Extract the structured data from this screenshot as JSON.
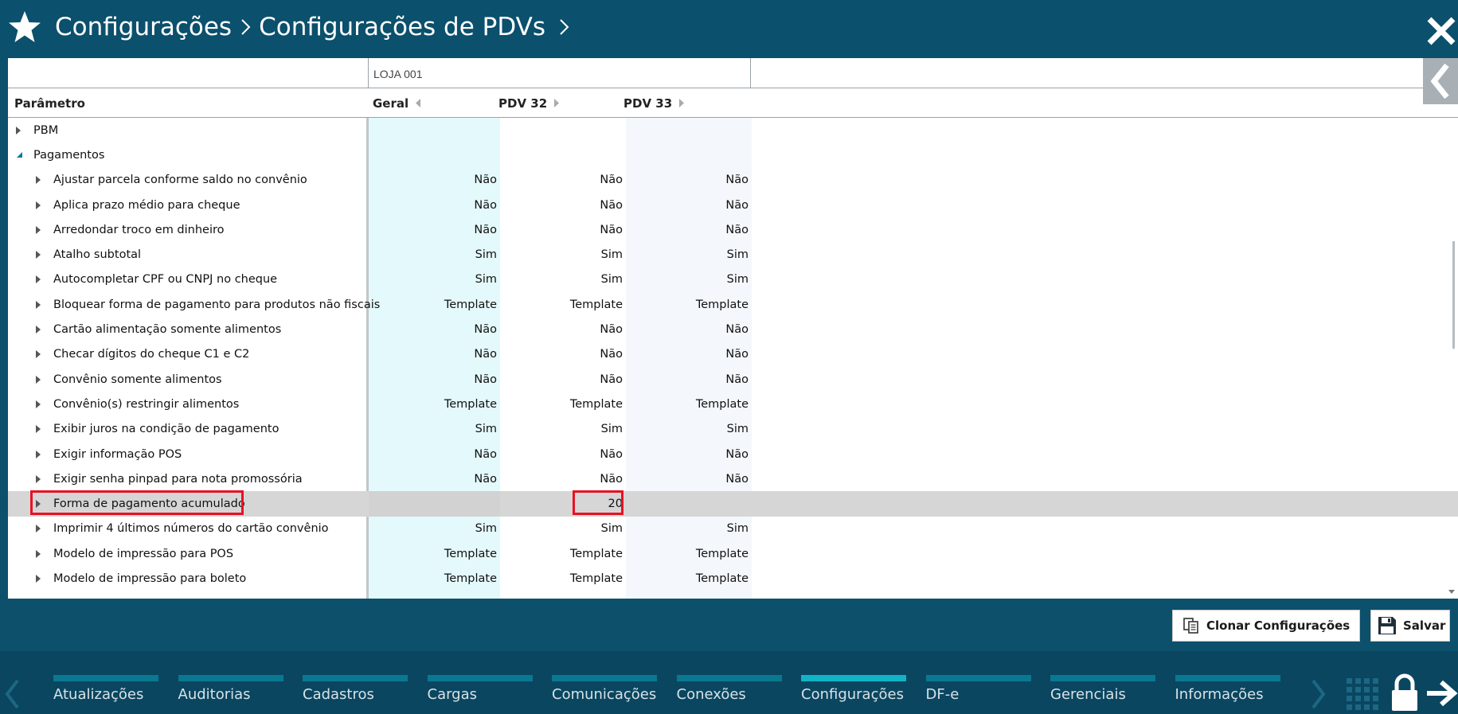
{
  "header": {
    "breadcrumbs": [
      "Configurações",
      "Configurações de PDVs"
    ]
  },
  "table": {
    "group_label": "LOJA 001",
    "columns": {
      "param": "Parâmetro",
      "geral": "Geral",
      "pdv32": "PDV 32",
      "pdv33": "PDV 33"
    },
    "rows": [
      {
        "label": "PBM",
        "level": 0,
        "expanded": false,
        "geral": "",
        "pdv32": "",
        "pdv33": ""
      },
      {
        "label": "Pagamentos",
        "level": 0,
        "expanded": true,
        "geral": "",
        "pdv32": "",
        "pdv33": ""
      },
      {
        "label": "Ajustar parcela conforme saldo no convênio",
        "level": 1,
        "geral": "Não",
        "pdv32": "Não",
        "pdv33": "Não"
      },
      {
        "label": "Aplica prazo médio para cheque",
        "level": 1,
        "geral": "Não",
        "pdv32": "Não",
        "pdv33": "Não"
      },
      {
        "label": "Arredondar troco em dinheiro",
        "level": 1,
        "geral": "Não",
        "pdv32": "Não",
        "pdv33": "Não"
      },
      {
        "label": "Atalho subtotal",
        "level": 1,
        "geral": "Sim",
        "pdv32": "Sim",
        "pdv33": "Sim"
      },
      {
        "label": "Autocompletar CPF ou CNPJ no cheque",
        "level": 1,
        "geral": "Sim",
        "pdv32": "Sim",
        "pdv33": "Sim"
      },
      {
        "label": "Bloquear forma de pagamento para produtos não fiscais",
        "level": 1,
        "geral": "Template",
        "pdv32": "Template",
        "pdv33": "Template"
      },
      {
        "label": "Cartão alimentação somente alimentos",
        "level": 1,
        "geral": "Não",
        "pdv32": "Não",
        "pdv33": "Não"
      },
      {
        "label": "Checar dígitos do cheque C1 e C2",
        "level": 1,
        "geral": "Não",
        "pdv32": "Não",
        "pdv33": "Não"
      },
      {
        "label": "Convênio somente alimentos",
        "level": 1,
        "geral": "Não",
        "pdv32": "Não",
        "pdv33": "Não"
      },
      {
        "label": "Convênio(s) restringir alimentos",
        "level": 1,
        "geral": "Template",
        "pdv32": "Template",
        "pdv33": "Template"
      },
      {
        "label": "Exibir juros na condição de pagamento",
        "level": 1,
        "geral": "Sim",
        "pdv32": "Sim",
        "pdv33": "Sim"
      },
      {
        "label": "Exigir informação POS",
        "level": 1,
        "geral": "Não",
        "pdv32": "Não",
        "pdv33": "Não"
      },
      {
        "label": "Exigir senha pinpad para nota promossória",
        "level": 1,
        "geral": "Não",
        "pdv32": "Não",
        "pdv33": "Não"
      },
      {
        "label": "Forma de pagamento acumulado",
        "level": 1,
        "selected": true,
        "geral": "",
        "pdv32": "20",
        "pdv33": ""
      },
      {
        "label": "Imprimir 4 últimos números do cartão convênio",
        "level": 1,
        "geral": "Sim",
        "pdv32": "Sim",
        "pdv33": "Sim"
      },
      {
        "label": "Modelo de impressão para POS",
        "level": 1,
        "geral": "Template",
        "pdv32": "Template",
        "pdv33": "Template"
      },
      {
        "label": "Modelo de impressão para boleto",
        "level": 1,
        "geral": "Template",
        "pdv32": "Template",
        "pdv33": "Template"
      }
    ]
  },
  "actions": {
    "clone_label": "Clonar Configurações",
    "save_label": "Salvar"
  },
  "footer": {
    "nav": [
      {
        "label": "Atualizações",
        "active": false
      },
      {
        "label": "Auditorias",
        "active": false
      },
      {
        "label": "Cadastros",
        "active": false
      },
      {
        "label": "Cargas",
        "active": false
      },
      {
        "label": "Comunicações",
        "active": false
      },
      {
        "label": "Conexões",
        "active": false
      },
      {
        "label": "Configurações",
        "active": true
      },
      {
        "label": "DF-e",
        "active": false
      },
      {
        "label": "Gerenciais",
        "active": false
      },
      {
        "label": "Informações",
        "active": false
      }
    ]
  },
  "colors": {
    "header_bg": "#0b506c",
    "col_geral_bg": "#e4f9fb",
    "col_pdv33_bg": "#f4f8fc",
    "highlight": "#e81122",
    "nav_active": "#11b3c7"
  },
  "icons": [
    "star-icon",
    "chevron-right-icon",
    "close-icon",
    "panel-collapse-icon",
    "expand-arrow-icon",
    "clone-icon",
    "save-icon",
    "grid-icon",
    "lock-icon",
    "logout-arrow-icon"
  ]
}
